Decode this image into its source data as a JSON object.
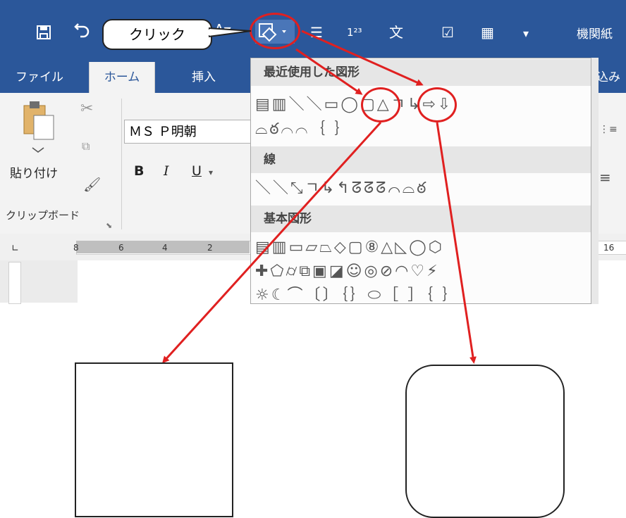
{
  "app": {
    "document_title": "機関紙"
  },
  "callout": {
    "text": "クリック"
  },
  "quick_access": {
    "save_icon": "save-icon",
    "undo_icon": "undo-icon",
    "shapes_icon": "shapes-icon",
    "icons_symbols": [
      "☰",
      "1²³",
      "文",
      "☑",
      "▦",
      "▾"
    ]
  },
  "tabs": [
    "ファイル",
    "ホーム",
    "挿入",
    "込み"
  ],
  "clipboard": {
    "paste_label": "貼り付け",
    "group_label": "クリップボード"
  },
  "font": {
    "name": "ＭＳ Ｐ明朝",
    "bold": "B",
    "italic": "I",
    "underline": "U"
  },
  "ruler": {
    "ticks": [
      "8",
      "6",
      "4",
      "2",
      "16"
    ]
  },
  "shapes_gallery": {
    "sections": [
      "最近使用した図形",
      "線",
      "基本図形"
    ],
    "recent_row1": "▤▥＼＼▭◯▢△ㄱ↳⇨⇩",
    "recent_row2": "⌓ఠ⌒⌒｛ ｝",
    "lines_row": "＼＼⤡ㄱ↳↰ᘔᘔᘔ⌒⌓ఠ",
    "basic_row1": "▤▥▭▱⏢◇▢⑧△◺◯⬡",
    "basic_row2": "✚⬠⌭⧉▣◪☺◎⊘◠♡⚡",
    "basic_row3": "☼☾⌒〔〕｛｝⬭［ ］｛ ｝"
  },
  "colors": {
    "ribbon_blue": "#2b579a",
    "highlight_red": "#e02020"
  }
}
